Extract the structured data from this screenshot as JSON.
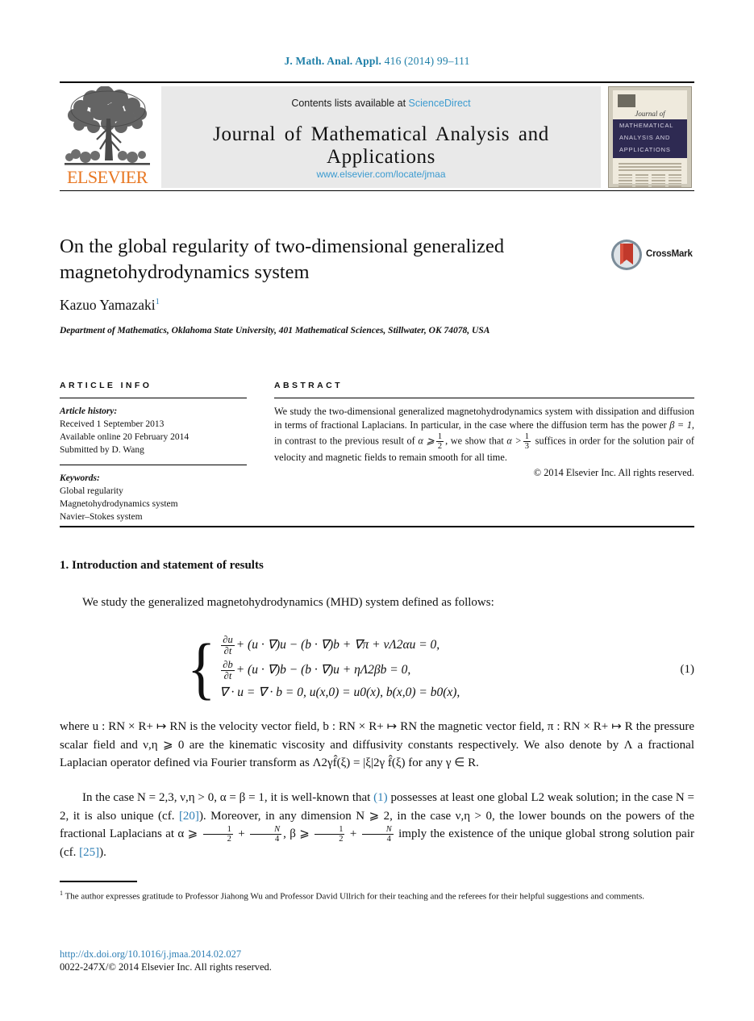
{
  "running_head": {
    "journal_abbrev": "J. Math. Anal. Appl.",
    "volume_year_pages": "416 (2014) 99–111"
  },
  "masthead": {
    "contents_prefix": "Contents lists available at",
    "sciencedirect": "ScienceDirect",
    "journal_name": "Journal of Mathematical Analysis and Applications",
    "journal_url": "www.elsevier.com/locate/jmaa",
    "publisher_wordmark": "ELSEVIER",
    "cover": {
      "journal_of": "Journal of",
      "band_line1": "MATHEMATICAL",
      "band_line2": "ANALYSIS AND",
      "band_line3": "APPLICATIONS"
    }
  },
  "article": {
    "title": "On the global regularity of two-dimensional generalized magnetohydrodynamics system",
    "author": "Kazuo Yamazaki",
    "author_footnote_marker": "1",
    "affiliation": "Department of Mathematics, Oklahoma State University, 401 Mathematical Sciences, Stillwater, OK 74078, USA",
    "crossmark_label": "CrossMark"
  },
  "info": {
    "heading": "ARTICLE INFO",
    "history_label": "Article history:",
    "history": [
      "Received 1 September 2013",
      "Available online 20 February 2014",
      "Submitted by D. Wang"
    ],
    "keywords_label": "Keywords:",
    "keywords": [
      "Global regularity",
      "Magnetohydrodynamics system",
      "Navier–Stokes system"
    ]
  },
  "abstract": {
    "heading": "ABSTRACT",
    "part1": "We study the two-dimensional generalized magnetohydrodynamics system with dissipation and diffusion in terms of fractional Laplacians. In particular, in the case where the diffusion term has the power ",
    "beta_eq": "β = 1",
    "part2": ", in contrast to the previous result of ",
    "alpha_ge": "α ⩾",
    "frac_half_num": "1",
    "frac_half_den": "2",
    "part3": ", we show that ",
    "alpha_gt": "α >",
    "frac_third_num": "1",
    "frac_third_den": "3",
    "part4": " suffices in order for the solution pair of velocity and magnetic fields to remain smooth for all time.",
    "copyright": "© 2014 Elsevier Inc. All rights reserved."
  },
  "body": {
    "section_number": "1.",
    "section_title": "Introduction and statement of results",
    "para1": "We study the generalized magnetohydrodynamics (MHD) system defined as follows:",
    "equation": {
      "number": "(1)",
      "line1_frac_num": "∂u",
      "line1_frac_den": "∂t",
      "line1_rest": "+ (u · ∇)u − (b · ∇)b + ∇π + νΛ2αu = 0,",
      "line2_frac_num": "∂b",
      "line2_frac_den": "∂t",
      "line2_rest": "+ (u · ∇)b − (b · ∇)u + ηΛ2βb = 0,",
      "line3": "∇ · u = ∇ · b = 0,    u(x,0) = u0(x), b(x,0) = b0(x),"
    },
    "para2_a": "where u : R",
    "para2": "where u : RN × R+ ↦ RN is the velocity vector field, b : RN × R+ ↦ RN the magnetic vector field, π : RN × R+ ↦ R the pressure scalar field and ν,η ⩾ 0 are the kinematic viscosity and diffusivity constants respectively. We also denote by Λ a fractional Laplacian operator defined via Fourier transform as Λ2γf̂(ξ) = |ξ|2γ f̂(ξ) for any γ ∈ R.",
    "para3_s1": "In the case N = 2,3, ν,η > 0, α = β = 1, it is well-known that ",
    "para3_cite1": "(1)",
    "para3_s2": " possesses at least one global L2 weak solution; in the case N = 2, it is also unique (cf. ",
    "para3_cite2": "[20]",
    "para3_s3": "). Moreover, in any dimension N ⩾ 2, in the case ν,η > 0, the lower bounds on the powers of the fractional Laplacians at α ⩾ ",
    "para3_s4": " + ",
    "para3_s5": ", β ⩾ ",
    "para3_s6": " imply the existence of the unique global strong solution pair (cf. ",
    "para3_cite3": "[25]",
    "para3_s7": ")."
  },
  "footnote": {
    "marker": "1",
    "text": "The author expresses gratitude to Professor Jiahong Wu and Professor David Ullrich for their teaching and the referees for their helpful suggestions and comments."
  },
  "footer": {
    "doi": "http://dx.doi.org/10.1016/j.jmaa.2014.02.027",
    "copyright": "0022-247X/© 2014 Elsevier Inc. All rights reserved."
  },
  "colors": {
    "link_blue": "#2f7fb5",
    "sciencedirect_blue": "#3c9bd0",
    "elsevier_orange": "#E87722",
    "cover_navy": "#2e2a52"
  }
}
